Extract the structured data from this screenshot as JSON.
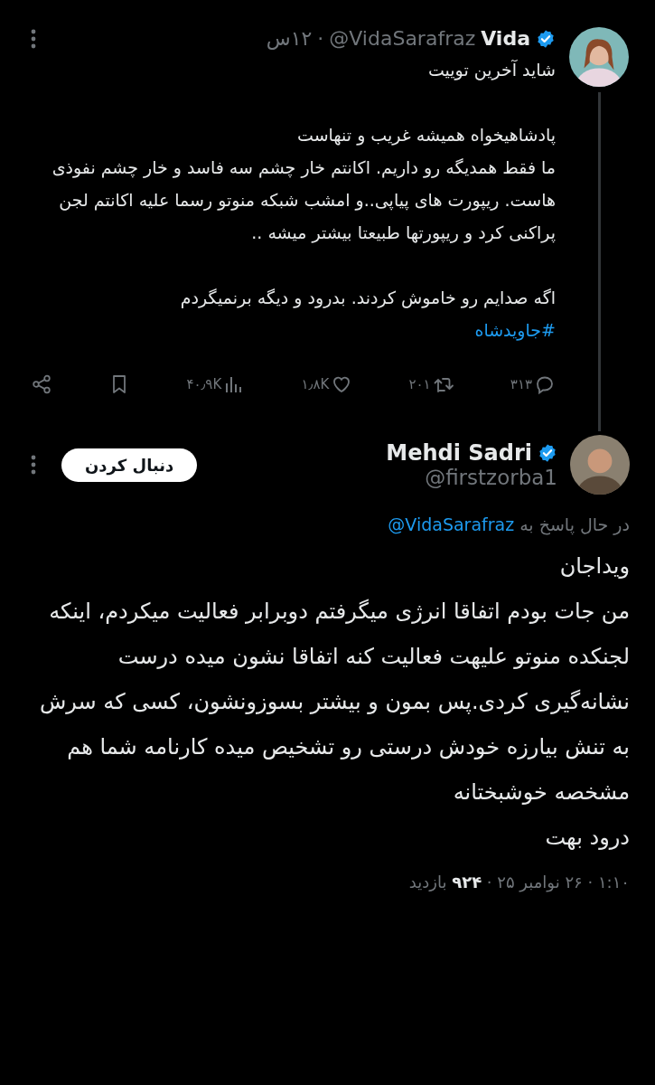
{
  "tweet": {
    "author": {
      "name": "Vida",
      "handle": "@VidaSarafraz",
      "verified": true
    },
    "separator": "·",
    "time": "۱۲س",
    "paragraphs": [
      "شاید آخرین توییت",
      "پادشاهیخواه همیشه غریب و تنهاست\nما فقط همدیگه رو داریم. اکانتم خار چشم سه فاسد و خار چشم نفوذی هاست. ریپورت های پیاپی..و امشب شبکه منوتو رسما علیه اکانتم لجن پراکنی کرد و ریپورتها طبیعتا بیشتر میشه ..",
      "اگه صدایم رو خاموش کردند. بدرود و دیگه برنمیگردم"
    ],
    "hashtag": "#جاویدشاه",
    "actions": [
      {
        "kind": "reply",
        "count": "۳۱۳"
      },
      {
        "kind": "retweet",
        "count": "۲۰۱"
      },
      {
        "kind": "like",
        "count": "۱٫۸K"
      },
      {
        "kind": "views",
        "count": "۴۰٫۹K"
      },
      {
        "kind": "bookmark"
      },
      {
        "kind": "share"
      }
    ]
  },
  "reply": {
    "author": {
      "name": "Mehdi Sadri",
      "handle": "@firstzorba1",
      "verified": true
    },
    "follow_button": "دنبال کردن",
    "replying_to": {
      "label": "در حال پاسخ به",
      "handle": "@VidaSarafraz"
    },
    "lines": [
      "ویداجان",
      "من جات بودم اتفاقا انرژی میگرفتم دوبرابر فعالیت میکردم، اینکه لجنکده منوتو علیهت فعالیت کنه اتفاقا نشون میده درست نشانه‌گیری کردی.پس بمون و بیشتر بسوزونشون، کسی که سرش به تنش بیارزه خودش درستی رو تشخیص میده کارنامه شما هم مشخصه خوشبختانه",
      "درود بهت"
    ],
    "footer": "۱:۱۰ · ۲۶ نوامبر ۲۵ · **۹۲۴** بازدید"
  }
}
